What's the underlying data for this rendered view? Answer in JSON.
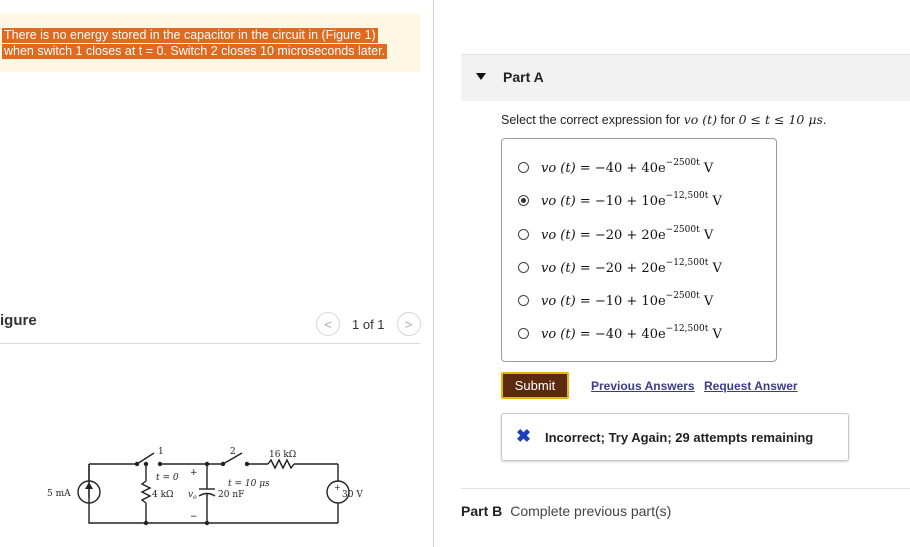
{
  "problem": {
    "line1": "There is no energy stored in the capacitor in the circuit in (Figure 1)",
    "line2": "when switch 1 closes at t = 0. Switch 2 closes 10 microseconds later."
  },
  "figure": {
    "title": "igure",
    "page": "1 of 1",
    "prev_icon": "<",
    "next_icon": ">"
  },
  "circuit": {
    "source_current": "5 mA",
    "r1": "4 kΩ",
    "switch1_label": "1",
    "switch1_time": "t = 0",
    "switch2_label": "2",
    "switch2_time": "t = 10 μs",
    "capacitor": "20 nF",
    "vo": "v",
    "vo_sub": "o",
    "plus": "+",
    "minus": "−",
    "r2": "16 kΩ",
    "source_voltage": "30 V"
  },
  "partA": {
    "label": "Part A",
    "question_prefix": "Select the correct expression for ",
    "question_var": "vo (t)",
    "question_mid": " for ",
    "question_range": "0 ≤ t ≤ 10 μs",
    "question_suffix": ".",
    "options": [
      {
        "lhs": "vo (t) = ",
        "expr": "−40 + 40e",
        "exp": "−2500t",
        "unit": " V",
        "selected": false
      },
      {
        "lhs": "vo (t) = ",
        "expr": "−10 + 10e",
        "exp": "−12,500t",
        "unit": " V",
        "selected": true
      },
      {
        "lhs": "vo (t) = ",
        "expr": "−20 + 20e",
        "exp": "−2500t",
        "unit": " V",
        "selected": false
      },
      {
        "lhs": "vo (t) = ",
        "expr": "−20 + 20e",
        "exp": "−12,500t",
        "unit": " V",
        "selected": false
      },
      {
        "lhs": "vo (t) = ",
        "expr": "−10 + 10e",
        "exp": "−2500t",
        "unit": " V",
        "selected": false
      },
      {
        "lhs": "vo (t) = ",
        "expr": "−40 + 40e",
        "exp": "−12,500t",
        "unit": " V",
        "selected": false
      }
    ],
    "submit": "Submit",
    "previous_answers": "Previous Answers",
    "request_answer": "Request Answer",
    "feedback_icon": "✖",
    "feedback": "Incorrect; Try Again; 29 attempts remaining"
  },
  "partB": {
    "label": "Part B",
    "text": "Complete previous part(s)"
  },
  "colors": {
    "highlight": "#e0681f",
    "submit_bg": "#5c2b0f",
    "submit_border": "#e8b400",
    "link": "#3b3b8f",
    "incorrect_icon": "#1f3fbf"
  }
}
